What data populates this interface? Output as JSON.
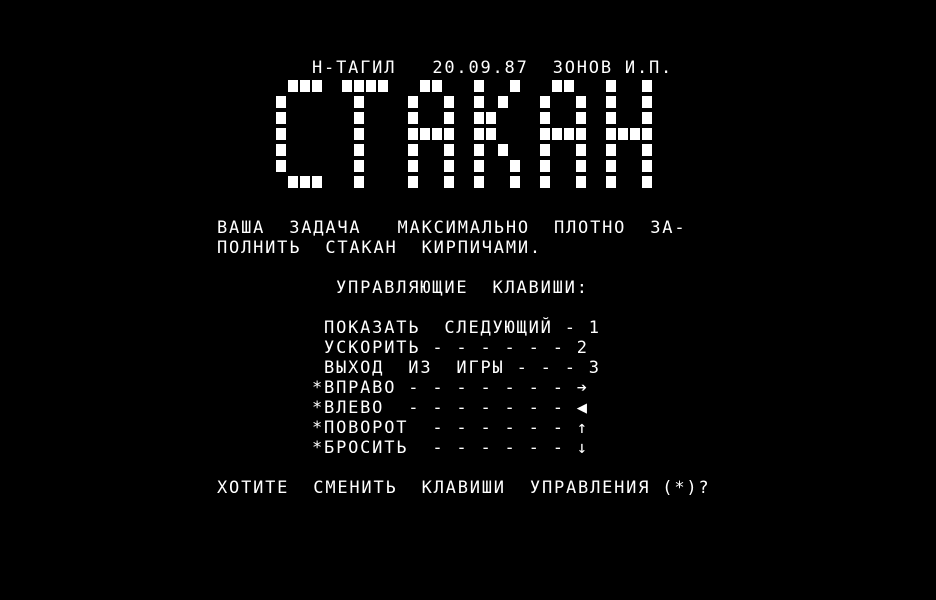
{
  "header_line": "Н-ТАГИЛ   20.09.87  ЗОНОВ И.П.",
  "title": "СТАКАН",
  "task_line_1": "ВАША  ЗАДАЧА   МАКСИМАЛЬНО  ПЛОТНО  ЗА-",
  "task_line_2": "ПОЛНИТЬ  СТАКАН  КИРПИЧАМИ.",
  "controls_heading": "УПРАВЛЯЮЩИЕ  КЛАВИШИ:",
  "controls": [
    {
      "label": " ПОКАЗАТЬ  СЛЕДУЮЩИЙ - 1"
    },
    {
      "label": " УСКОРИТЬ - - - - - - 2"
    },
    {
      "label": " ВЫХОД  ИЗ  ИГРЫ - - - 3"
    },
    {
      "label": "*ВПРАВО - - - - - - - ➔",
      "key_icon": "arrow-right-icon"
    },
    {
      "label": "*ВЛЕВО  - - - - - - - ◀",
      "key_icon": "arrow-left-icon"
    },
    {
      "label": "*ПОВОРОТ  - - - - - - ↑",
      "key_icon": "arrow-up-icon"
    },
    {
      "label": "*БРОСИТЬ  - - - - - - ↓",
      "key_icon": "arrow-down-icon"
    }
  ],
  "question": "ХОТИТЕ  СМЕНИТЬ  КЛАВИШИ  УПРАВЛЕНИЯ (*)?",
  "colors": {
    "background": "#000000",
    "text": "#ffffff"
  }
}
